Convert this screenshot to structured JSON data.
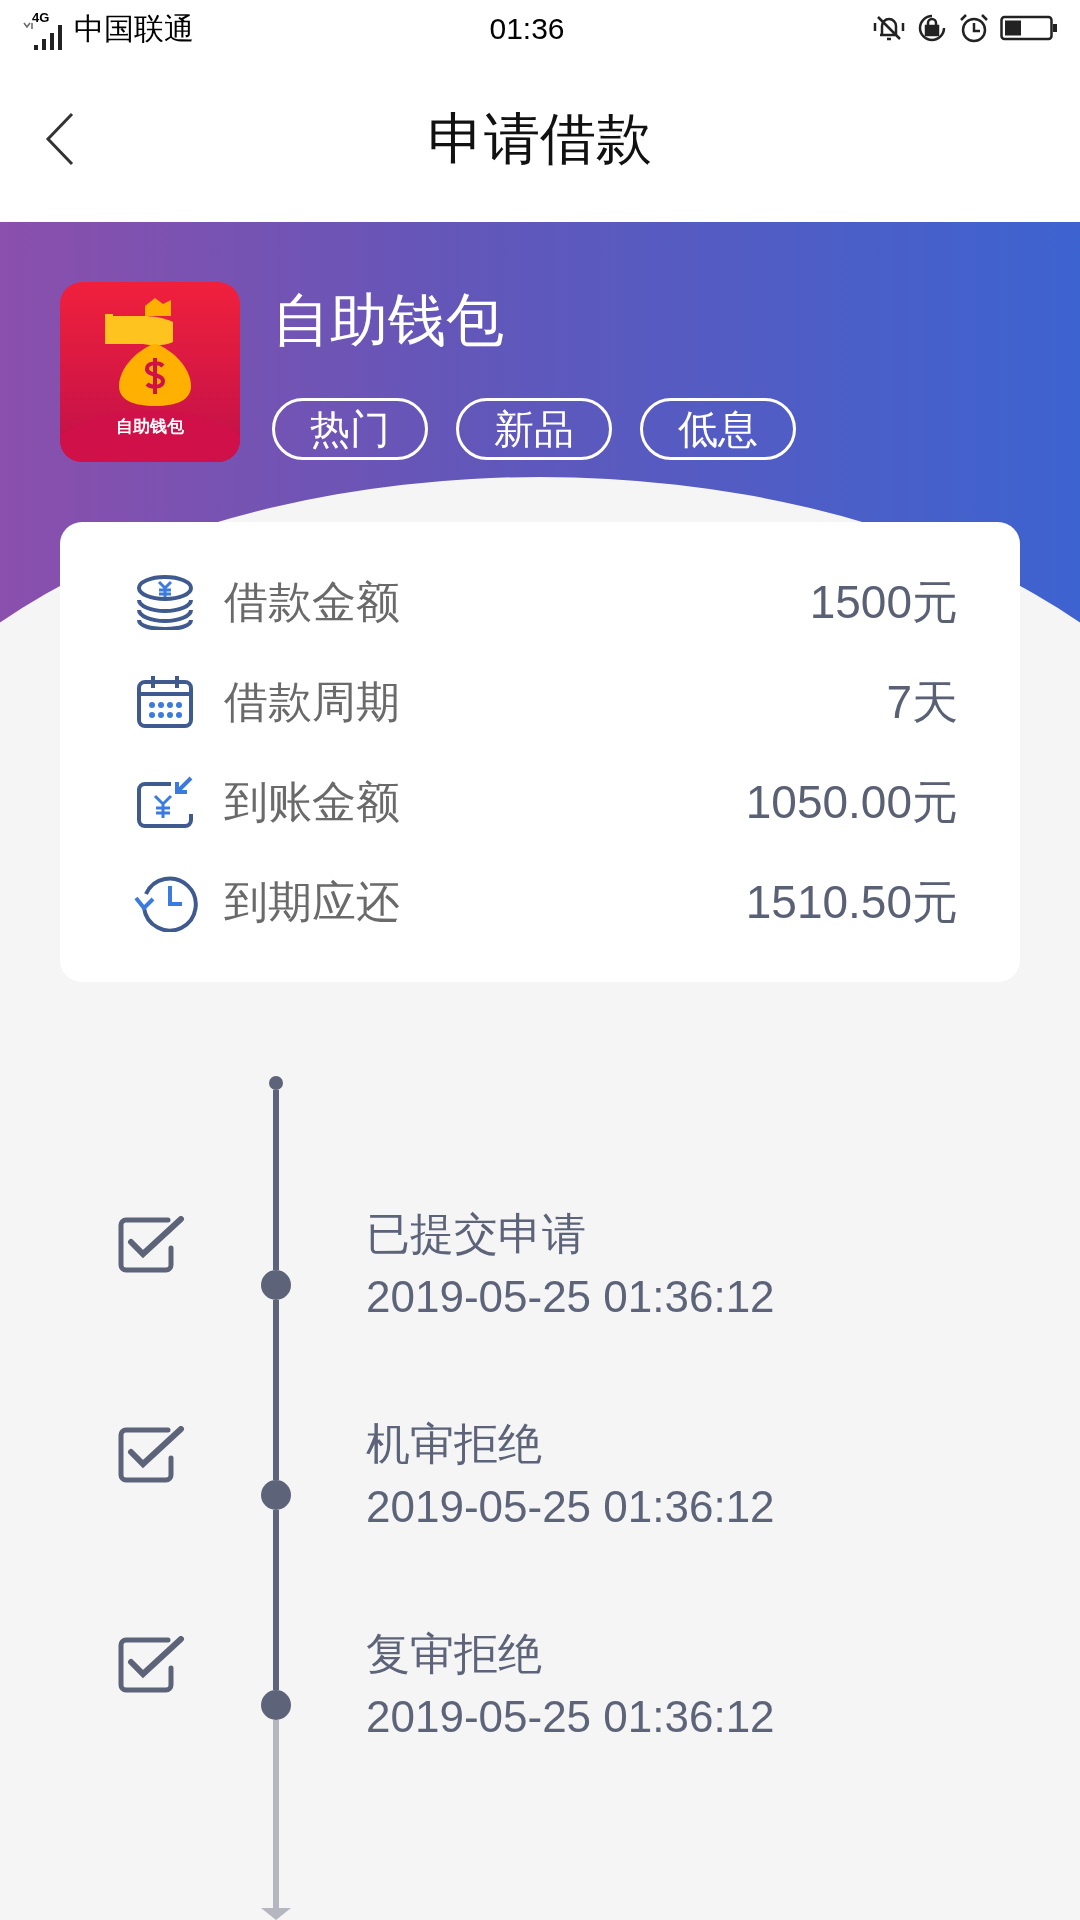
{
  "status_bar": {
    "network": "4G",
    "carrier": "中国联通",
    "time": "01:36"
  },
  "header": {
    "title": "申请借款"
  },
  "product": {
    "logo_text": "自助钱包",
    "name": "自助钱包",
    "tags": [
      "热门",
      "新品",
      "低息"
    ]
  },
  "details": [
    {
      "kind": "coins",
      "label": "借款金额",
      "value": "1500元"
    },
    {
      "kind": "calendar",
      "label": "借款周期",
      "value": "7天"
    },
    {
      "kind": "received",
      "label": "到账金额",
      "value": "1050.00元"
    },
    {
      "kind": "due",
      "label": "到期应还",
      "value": "1510.50元"
    }
  ],
  "timeline": [
    {
      "title": "已提交申请",
      "time": "2019-05-25 01:36:12",
      "checked": true
    },
    {
      "title": "机审拒绝",
      "time": "2019-05-25 01:36:12",
      "checked": true
    },
    {
      "title": "复审拒绝",
      "time": "2019-05-25 01:36:12",
      "checked": true
    }
  ]
}
